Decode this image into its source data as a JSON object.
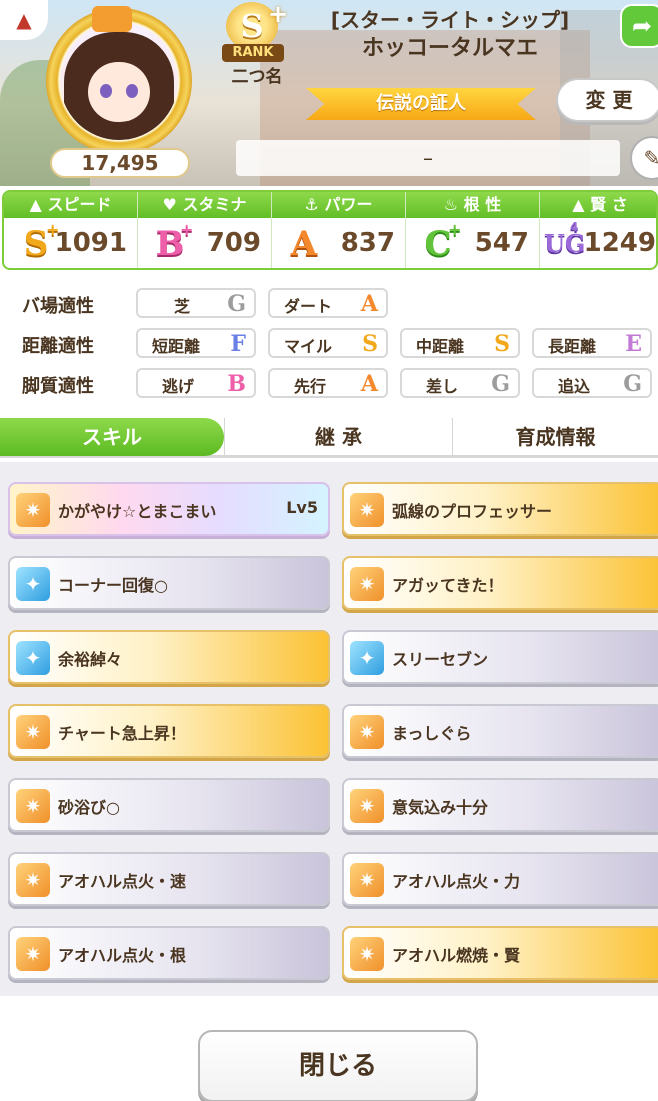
{
  "profile": {
    "fans": "17,495",
    "rank": "S",
    "rank_plus": "+",
    "rank_label": "RANK",
    "nickname": "二つ名",
    "epithet": "[スター・ライト・シップ]",
    "name": "ホッコータルマエ",
    "title": "伝説の証人",
    "change_label": "変 更",
    "comment": "–"
  },
  "stats": [
    {
      "label": "スピード",
      "icon": "shoe-icon",
      "grade": "S",
      "grade_sup": "+",
      "value": "1091"
    },
    {
      "label": "スタミナ",
      "icon": "heart-icon",
      "grade": "B",
      "grade_sup": "+",
      "value": "709"
    },
    {
      "label": "パワー",
      "icon": "muscle-icon",
      "grade": "A",
      "grade_sup": "",
      "value": "837"
    },
    {
      "label": "根 性",
      "icon": "flame-icon",
      "grade": "C",
      "grade_sup": "+",
      "value": "547"
    },
    {
      "label": "賢 さ",
      "icon": "graduation-cap-icon",
      "grade": "UG",
      "grade_sup": "4",
      "value": "1249"
    }
  ],
  "aptitude": {
    "track": {
      "label": "バ場適性",
      "items": [
        {
          "name": "芝",
          "grade": "G"
        },
        {
          "name": "ダート",
          "grade": "A"
        }
      ]
    },
    "distance": {
      "label": "距離適性",
      "items": [
        {
          "name": "短距離",
          "grade": "F"
        },
        {
          "name": "マイル",
          "grade": "S"
        },
        {
          "name": "中距離",
          "grade": "S"
        },
        {
          "name": "長距離",
          "grade": "E"
        }
      ]
    },
    "style": {
      "label": "脚質適性",
      "items": [
        {
          "name": "逃げ",
          "grade": "B"
        },
        {
          "name": "先行",
          "grade": "A"
        },
        {
          "name": "差し",
          "grade": "G"
        },
        {
          "name": "追込",
          "grade": "G"
        }
      ]
    }
  },
  "tabs": [
    "スキル",
    "継 承",
    "育成情報"
  ],
  "skills": [
    {
      "name": "かがやけ☆とまこまい",
      "level": "Lv5",
      "style": "rainbow",
      "icon": "orange"
    },
    {
      "name": "弧線のプロフェッサー",
      "level": "",
      "style": "gold",
      "icon": "orange"
    },
    {
      "name": "コーナー回復○",
      "level": "",
      "style": "silver",
      "icon": "blue"
    },
    {
      "name": "アガッてきた！",
      "level": "",
      "style": "gold",
      "icon": "orange"
    },
    {
      "name": "余裕綽々",
      "level": "",
      "style": "gold",
      "icon": "blue"
    },
    {
      "name": "スリーセブン",
      "level": "",
      "style": "silver",
      "icon": "blue"
    },
    {
      "name": "チャート急上昇！",
      "level": "",
      "style": "gold",
      "icon": "orange"
    },
    {
      "name": "まっしぐら",
      "level": "",
      "style": "silver",
      "icon": "orange"
    },
    {
      "name": "砂浴び○",
      "level": "",
      "style": "silver",
      "icon": "orange"
    },
    {
      "name": "意気込み十分",
      "level": "",
      "style": "silver",
      "icon": "orange"
    },
    {
      "name": "アオハル点火・速",
      "level": "",
      "style": "silver",
      "icon": "orange"
    },
    {
      "name": "アオハル点火・力",
      "level": "",
      "style": "silver",
      "icon": "orange"
    },
    {
      "name": "アオハル点火・根",
      "level": "",
      "style": "silver",
      "icon": "orange"
    },
    {
      "name": "アオハル燃焼・賢",
      "level": "",
      "style": "gold",
      "icon": "orange"
    }
  ],
  "close_label": "閉じる",
  "colors": {
    "accent_green": "#62bf26",
    "gold": "#f7a815"
  }
}
